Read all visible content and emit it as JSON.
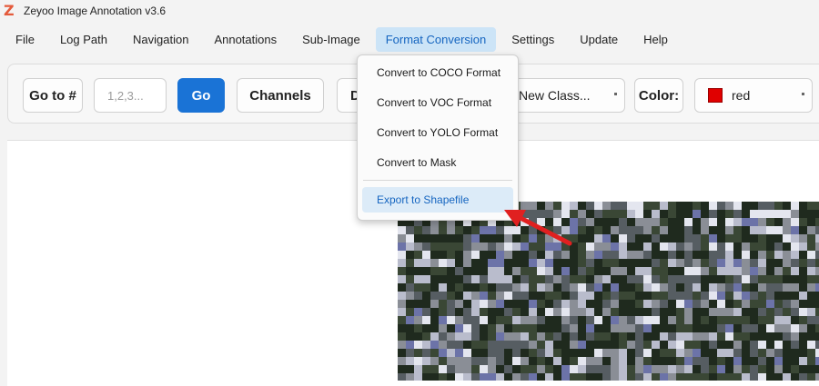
{
  "app": {
    "title": "Zeyoo Image Annotation v3.6",
    "icon": "Z"
  },
  "menu": [
    {
      "label": "File"
    },
    {
      "label": "Log Path"
    },
    {
      "label": "Navigation"
    },
    {
      "label": "Annotations"
    },
    {
      "label": "Sub-Image"
    },
    {
      "label": "Format Conversion",
      "active": true
    },
    {
      "label": "Settings"
    },
    {
      "label": "Update"
    },
    {
      "label": "Help"
    }
  ],
  "toolbar": {
    "goto_label": "Go to #",
    "goto_placeholder": "1,2,3...",
    "go_label": "Go",
    "channels_label": "Channels",
    "partial_label": "D",
    "class_select": "New Class...",
    "color_label": "Color:",
    "color_value": "red",
    "color_swatch": "#e00000"
  },
  "dropdown": {
    "items": [
      {
        "label": "Convert to COCO Format"
      },
      {
        "label": "Convert to VOC Format"
      },
      {
        "label": "Convert to YOLO Format"
      },
      {
        "label": "Convert to Mask"
      },
      {
        "label": "Export to Shapefile",
        "highlighted": true
      }
    ]
  },
  "colors": {
    "accent": "#1a73d6",
    "menu_active_bg": "#cce4f7",
    "annotation_arrow": "#e02020"
  }
}
